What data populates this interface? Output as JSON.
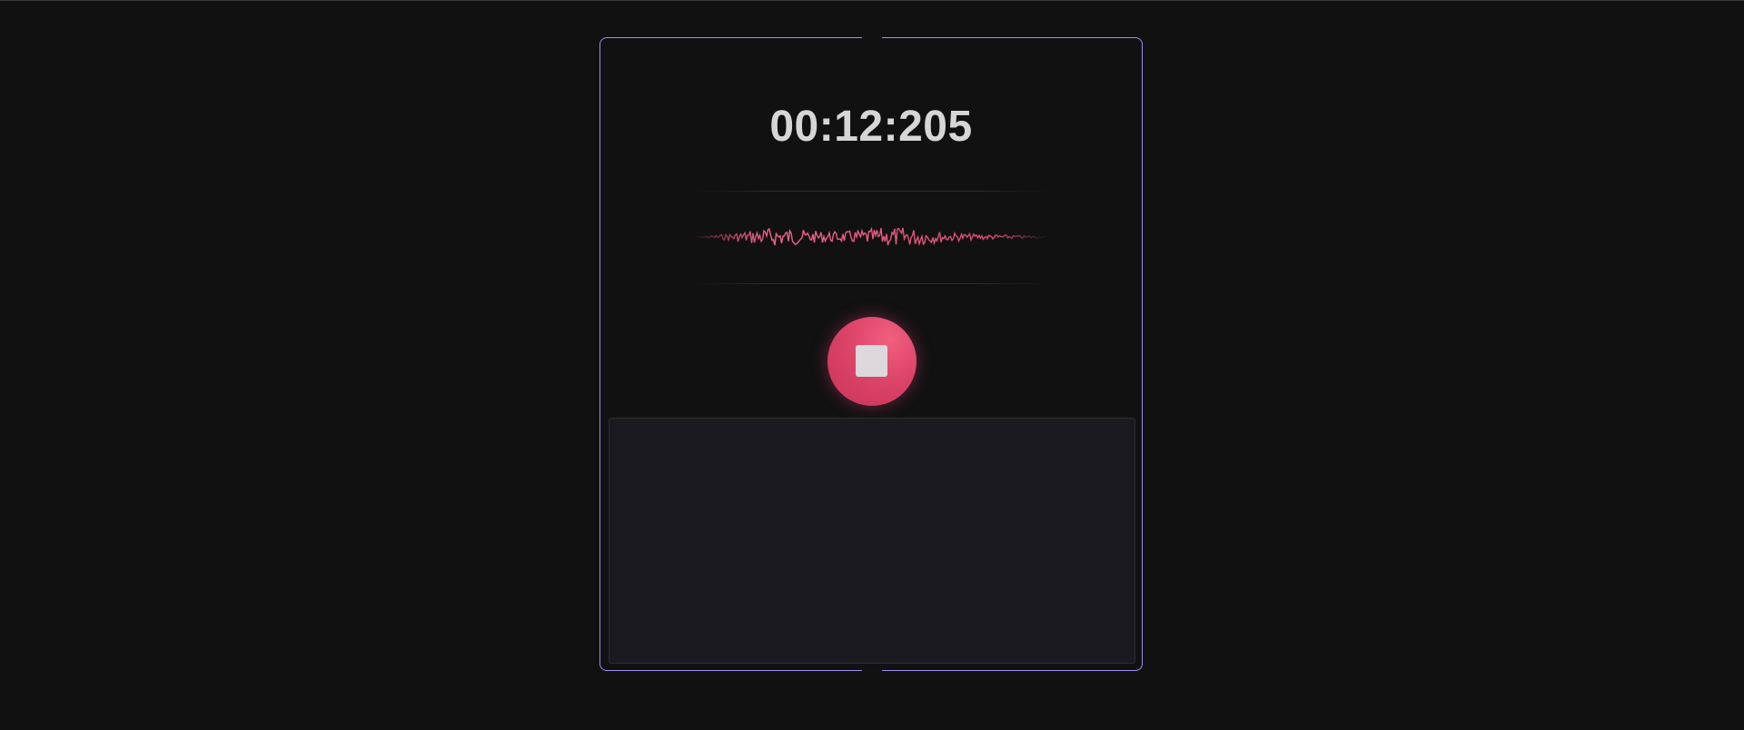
{
  "recorder": {
    "timer_text": "00:12:205",
    "state": "recording",
    "stop_button_label": "stop-icon",
    "transcript_text": ""
  },
  "colors": {
    "background": "#111111",
    "card_border": "#9b8ef0",
    "accent": "#dc4468",
    "waveform": "#e8557c",
    "panel": "#1b1a20"
  },
  "icons": {
    "stop": "stop-icon",
    "waveform": "audio-waveform"
  }
}
